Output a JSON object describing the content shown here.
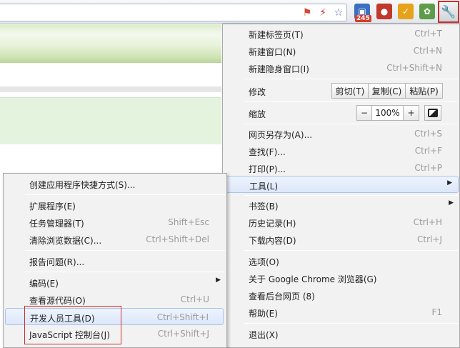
{
  "toolbar": {
    "omnibox_icons": [
      "bookmark-flag-icon",
      "lightning-icon",
      "star-icon"
    ],
    "extensions": [
      {
        "name": "ext-1",
        "badge": "245",
        "color": "#3b6fbf"
      },
      {
        "name": "ext-2",
        "color": "#c0392b"
      },
      {
        "name": "ext-3",
        "color": "#e6a21a"
      },
      {
        "name": "ext-4",
        "color": "#5e9c4a"
      }
    ],
    "wrench_icon": "wrench-icon"
  },
  "main_menu": {
    "new_tab": {
      "label": "新建标签页(T)",
      "shortcut": "Ctrl+T"
    },
    "new_window": {
      "label": "新建窗口(N)",
      "shortcut": "Ctrl+N"
    },
    "new_incognito": {
      "label": "新建隐身窗口(I)",
      "shortcut": "Ctrl+Shift+N"
    },
    "edit": {
      "label": "修改",
      "cut": "剪切(T)",
      "copy": "复制(C)",
      "paste": "粘贴(P)"
    },
    "zoom": {
      "label": "缩放",
      "minus": "−",
      "value": "100%",
      "plus": "+"
    },
    "save_as": {
      "label": "网页另存为(A)...",
      "shortcut": "Ctrl+S"
    },
    "find": {
      "label": "查找(F)...",
      "shortcut": "Ctrl+F"
    },
    "print": {
      "label": "打印(P)...",
      "shortcut": "Ctrl+P"
    },
    "tools": {
      "label": "工具(L)"
    },
    "bookmarks": {
      "label": "书签(B)"
    },
    "history": {
      "label": "历史记录(H)",
      "shortcut": "Ctrl+H"
    },
    "downloads": {
      "label": "下载内容(D)",
      "shortcut": "Ctrl+J"
    },
    "options": {
      "label": "选项(O)"
    },
    "about": {
      "label": "关于 Google Chrome 浏览器(G)"
    },
    "background_pages": {
      "label": "查看后台网页 (8)"
    },
    "help": {
      "label": "帮助(E)",
      "shortcut": "F1"
    },
    "exit": {
      "label": "退出(X)"
    }
  },
  "tools_menu": {
    "create_shortcuts": {
      "label": "创建应用程序快捷方式(S)..."
    },
    "extensions": {
      "label": "扩展程序(E)"
    },
    "task_manager": {
      "label": "任务管理器(T)",
      "shortcut": "Shift+Esc"
    },
    "clear_data": {
      "label": "清除浏览数据(C)...",
      "shortcut": "Ctrl+Shift+Del"
    },
    "report_issue": {
      "label": "报告问题(R)..."
    },
    "encoding": {
      "label": "编码(E)"
    },
    "view_source": {
      "label": "查看源代码(O)",
      "shortcut": "Ctrl+U"
    },
    "dev_tools": {
      "label": "开发人员工具(D)",
      "shortcut": "Ctrl+Shift+I"
    },
    "js_console": {
      "label": "JavaScript 控制台(J)",
      "shortcut": "Ctrl+Shift+J"
    }
  },
  "colors": {
    "highlight_box": "#d22b2b",
    "menu_hover": "#dbe7fa"
  }
}
